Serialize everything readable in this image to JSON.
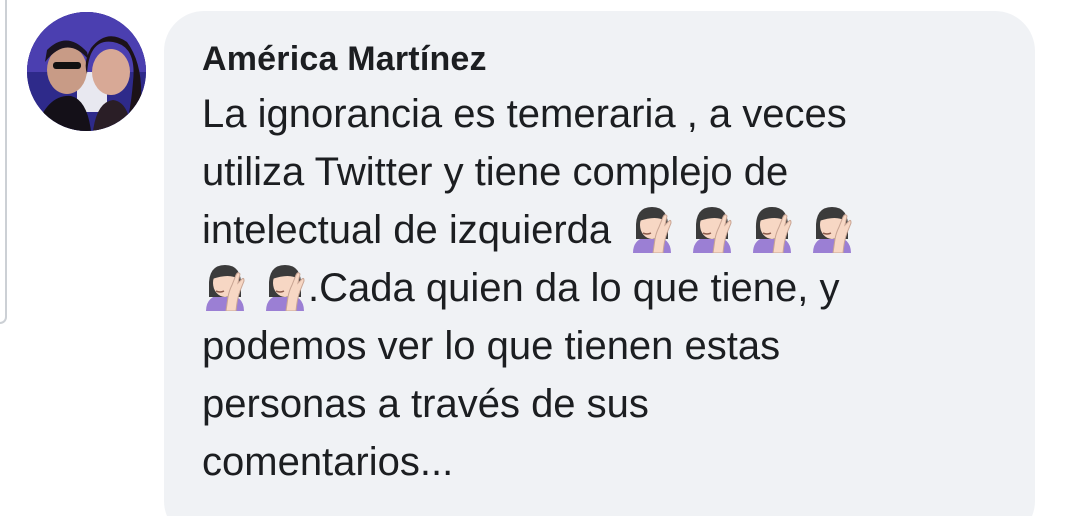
{
  "comment": {
    "author": "América Martínez",
    "text_lines": [
      "La ignorancia es temeraria ,  a veces",
      "utiliza Twitter y tiene complejo de",
      "intelectual de izquierda",
      ".Cada quien da lo que tiene, y",
      "podemos ver lo que tienen estas",
      "personas a través de sus",
      "comentarios..."
    ],
    "emoji": "woman-facepalming-icon",
    "emoji_count_line3": 4,
    "emoji_count_line4": 2
  },
  "colors": {
    "bubble": "#f0f2f5",
    "text": "#1c1e21",
    "emoji_shirt": "#9b7fd4",
    "emoji_hair": "#3b3b3b",
    "emoji_skin": "#f7d7c4"
  }
}
